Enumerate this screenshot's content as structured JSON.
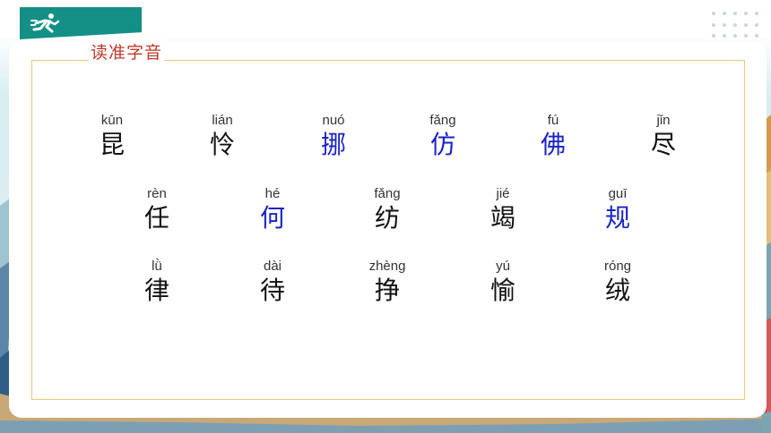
{
  "section_title": "读准字音",
  "colors": {
    "header": "#138f86",
    "title": "#c0392b",
    "highlight": "#1a23c8",
    "frame": "#ecc97a"
  },
  "header": {
    "icon": "running-figure-icon"
  },
  "rows": [
    [
      {
        "pinyin": "kūn",
        "char": "昆",
        "highlight": false
      },
      {
        "pinyin": "lián",
        "char": "怜",
        "highlight": false
      },
      {
        "pinyin": "nuó",
        "char": "挪",
        "highlight": true
      },
      {
        "pinyin": "fǎng",
        "char": "仿",
        "highlight": true
      },
      {
        "pinyin": "fú",
        "char": "佛",
        "highlight": true
      },
      {
        "pinyin": "jǐn",
        "char": "尽",
        "highlight": false
      }
    ],
    [
      {
        "pinyin": "rèn",
        "char": "任",
        "highlight": false
      },
      {
        "pinyin": "hé",
        "char": "何",
        "highlight": true
      },
      {
        "pinyin": "fǎng",
        "char": "纺",
        "highlight": false
      },
      {
        "pinyin": "jié",
        "char": "竭",
        "highlight": false
      },
      {
        "pinyin": "guī",
        "char": "规",
        "highlight": true
      }
    ],
    [
      {
        "pinyin": "lǜ",
        "char": "律",
        "highlight": false
      },
      {
        "pinyin": "dài",
        "char": "待",
        "highlight": false
      },
      {
        "pinyin": "zhèng",
        "char": "挣",
        "highlight": false
      },
      {
        "pinyin": "yú",
        "char": "愉",
        "highlight": false
      },
      {
        "pinyin": "róng",
        "char": "绒",
        "highlight": false
      }
    ]
  ]
}
